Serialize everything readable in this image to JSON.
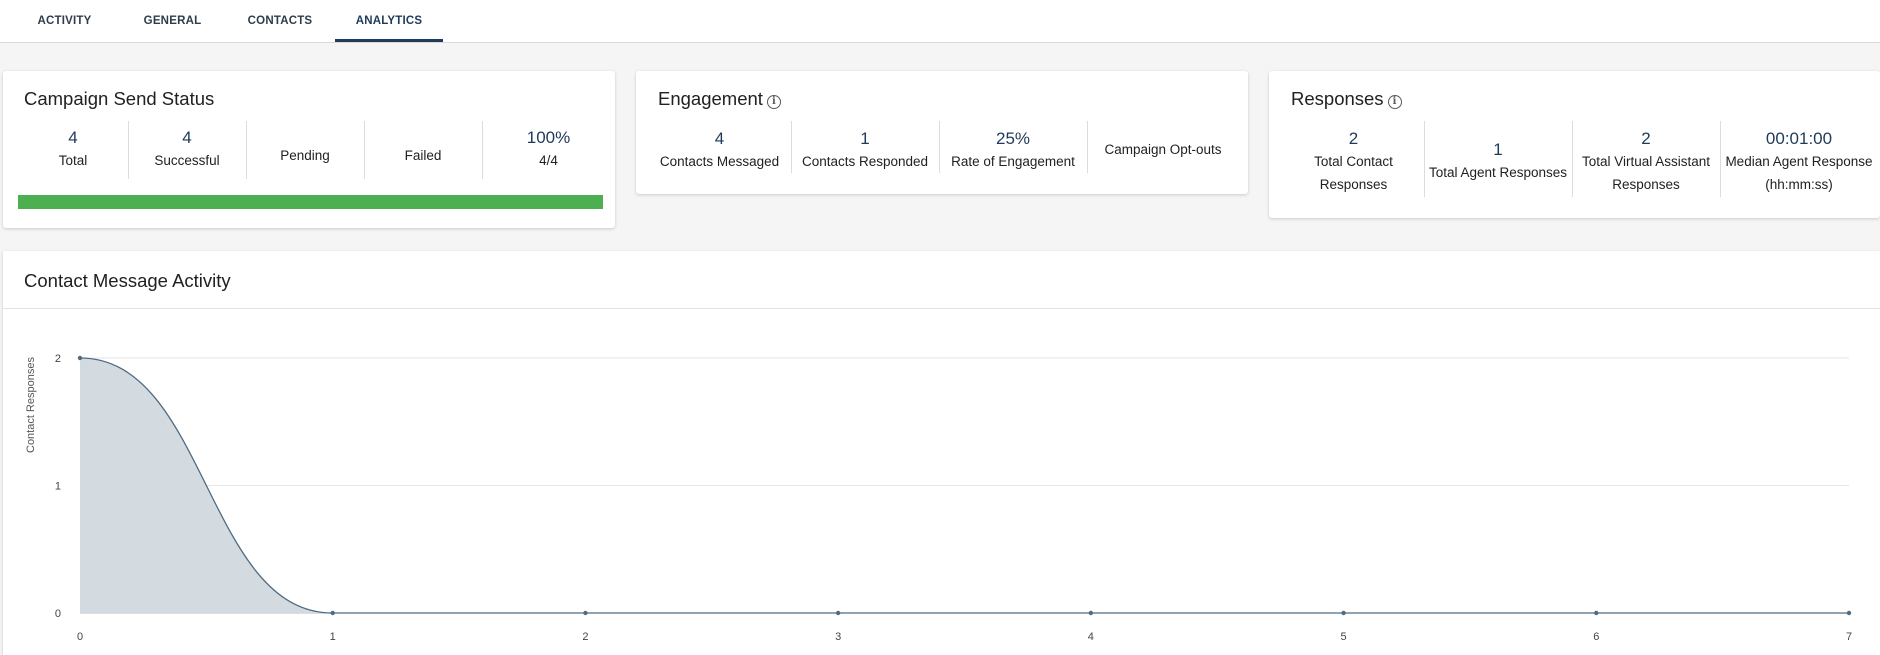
{
  "tabs": [
    {
      "label": "ACTIVITY",
      "active": false
    },
    {
      "label": "GENERAL",
      "active": false
    },
    {
      "label": "CONTACTS",
      "active": false
    },
    {
      "label": "ANALYTICS",
      "active": true
    }
  ],
  "send_status": {
    "title": "Campaign Send Status",
    "stats": [
      {
        "value": "4",
        "label": "Total"
      },
      {
        "value": "4",
        "label": "Successful"
      },
      {
        "value": "",
        "label": "Pending"
      },
      {
        "value": "",
        "label": "Failed"
      },
      {
        "value": "100%",
        "label": "4/4"
      }
    ],
    "progress": 1.0,
    "progress_color": "#4caf50"
  },
  "engagement": {
    "title": "Engagement",
    "stats": [
      {
        "value": "4",
        "label": "Contacts Messaged"
      },
      {
        "value": "1",
        "label": "Contacts Responded"
      },
      {
        "value": "25%",
        "label": "Rate of Engagement"
      },
      {
        "value": "",
        "label": "Campaign Opt-outs"
      }
    ]
  },
  "responses": {
    "title": "Responses",
    "stats": [
      {
        "value": "2",
        "label": "Total Contact Responses"
      },
      {
        "value": "1",
        "label": "Total Agent Responses"
      },
      {
        "value": "2",
        "label": "Total Virtual Assistant Responses"
      },
      {
        "value": "00:01:00",
        "label": "Median Agent Response (hh:mm:ss)"
      }
    ]
  },
  "activity_chart": {
    "title": "Contact Message Activity"
  },
  "chart_data": {
    "type": "area",
    "x": [
      0,
      1,
      2,
      3,
      4,
      5,
      6,
      7
    ],
    "values": [
      2,
      0,
      0,
      0,
      0,
      0,
      0,
      0
    ],
    "xlabel": "",
    "ylabel": "Contact Responses",
    "xlim": [
      0,
      7
    ],
    "ylim": [
      0,
      2
    ],
    "yticks": [
      "0",
      "1",
      "2"
    ],
    "xticks": [
      "0",
      "1",
      "2",
      "3",
      "4",
      "5",
      "6",
      "7"
    ],
    "grid": true,
    "line_color": "#4f6b82",
    "fill_color": "#d3dbe0"
  }
}
